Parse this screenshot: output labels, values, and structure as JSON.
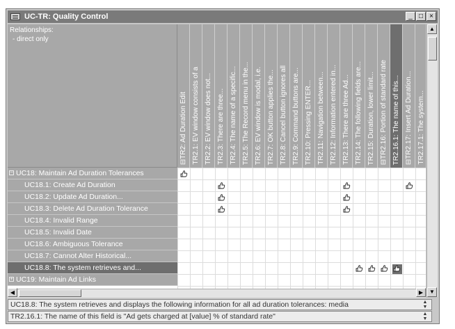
{
  "window": {
    "title": "UC-TR: Quality Control",
    "controls": {
      "minimize": "_",
      "maximize": "□",
      "close": "×"
    }
  },
  "corner": {
    "heading": "Relationships:",
    "value": "- direct only"
  },
  "columns": [
    {
      "label": "TR2: Ad Duration Edit",
      "prefix": "⊟",
      "selected": false
    },
    {
      "label": "TR2.1: EV window consists of a",
      "prefix": "",
      "selected": false
    },
    {
      "label": "TR2.2: EV window does not...",
      "prefix": "",
      "selected": false
    },
    {
      "label": "TR2.3: There are three...",
      "prefix": "",
      "selected": false
    },
    {
      "label": "TR2.4: The name of a specific...",
      "prefix": "",
      "selected": false
    },
    {
      "label": "TR2.5: The Record menu in the...",
      "prefix": "",
      "selected": false
    },
    {
      "label": "TR2.6: EV window is modal, i.e.",
      "prefix": "",
      "selected": false
    },
    {
      "label": "TR2.7: OK button applies the...",
      "prefix": "",
      "selected": false
    },
    {
      "label": "TR2.8: Cancel button ignores all",
      "prefix": "",
      "selected": false
    },
    {
      "label": "TR2.9: Command buttons are...",
      "prefix": "",
      "selected": false
    },
    {
      "label": "TR2.10: Pressing ENTER...",
      "prefix": "",
      "selected": false
    },
    {
      "label": "TR2.11: Navigation between...",
      "prefix": "",
      "selected": false
    },
    {
      "label": "TR2.12: Information entered in...",
      "prefix": "",
      "selected": false
    },
    {
      "label": "TR2.13: There are three Ad...",
      "prefix": "",
      "selected": false
    },
    {
      "label": "TR2.14: The following fields are...",
      "prefix": "",
      "selected": false
    },
    {
      "label": "TR2.15: Duration, lower limit...",
      "prefix": "",
      "selected": false
    },
    {
      "label": "TR2.16: Portion of standard rate",
      "prefix": "⊟",
      "selected": false
    },
    {
      "label": "TR2.16.1: The name of this...",
      "prefix": "",
      "selected": true
    },
    {
      "label": "TR2.17: Insert Ad Duration...",
      "prefix": "⊟",
      "selected": false
    },
    {
      "label": "TR2.17.1: The system...",
      "prefix": "",
      "selected": false
    }
  ],
  "rows": [
    {
      "label": "UC18: Maintain Ad Duration Tolerances",
      "indent": 0,
      "expander": "−",
      "selected": false,
      "marks": [
        0
      ]
    },
    {
      "label": "UC18.1: Create Ad Duration",
      "indent": 1,
      "expander": "",
      "selected": false,
      "marks": [
        3,
        13,
        18
      ]
    },
    {
      "label": "UC18.2: Update Ad Duration...",
      "indent": 1,
      "expander": "",
      "selected": false,
      "marks": [
        3,
        13
      ]
    },
    {
      "label": "UC18.3: Delete Ad Duration Tolerance",
      "indent": 1,
      "expander": "",
      "selected": false,
      "marks": [
        3,
        13
      ]
    },
    {
      "label": "UC18.4: Invalid Range",
      "indent": 1,
      "expander": "",
      "selected": false,
      "marks": []
    },
    {
      "label": "UC18.5: Invalid Date",
      "indent": 1,
      "expander": "",
      "selected": false,
      "marks": []
    },
    {
      "label": "UC18.6: Ambiguous Tolerance",
      "indent": 1,
      "expander": "",
      "selected": false,
      "marks": []
    },
    {
      "label": "UC18.7: Cannot Alter Historical...",
      "indent": 1,
      "expander": "",
      "selected": false,
      "marks": []
    },
    {
      "label": "UC18.8: The system retrieves and...",
      "indent": 1,
      "expander": "",
      "selected": true,
      "marks": [
        14,
        15,
        16,
        17
      ]
    },
    {
      "label": "UC19: Maintain Ad Links",
      "indent": 0,
      "expander": "+",
      "selected": false,
      "marks": []
    }
  ],
  "selected_mark": {
    "row": 8,
    "col": 17
  },
  "status": {
    "line1": "UC18.8: The system retrieves and displays the following information for all ad duration tolerances: media",
    "line2": "TR2.16.1: The name of this field is \"Ad gets charged at [value] % of standard rate\""
  }
}
